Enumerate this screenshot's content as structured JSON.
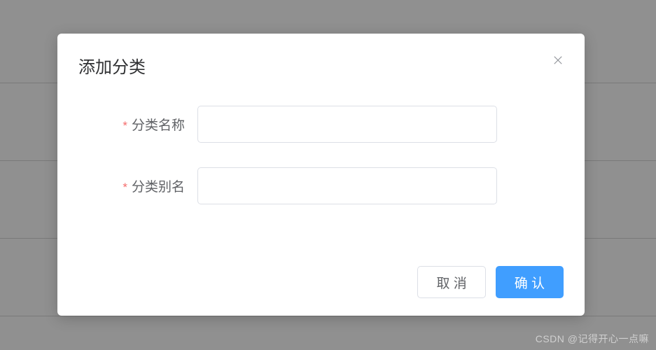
{
  "modal": {
    "title": "添加分类",
    "fields": {
      "category_name": {
        "label": "分类名称",
        "value": ""
      },
      "category_alias": {
        "label": "分类别名",
        "value": ""
      }
    },
    "buttons": {
      "cancel": "取 消",
      "confirm": "确 认"
    }
  },
  "watermark": "CSDN @记得开心一点嘛"
}
